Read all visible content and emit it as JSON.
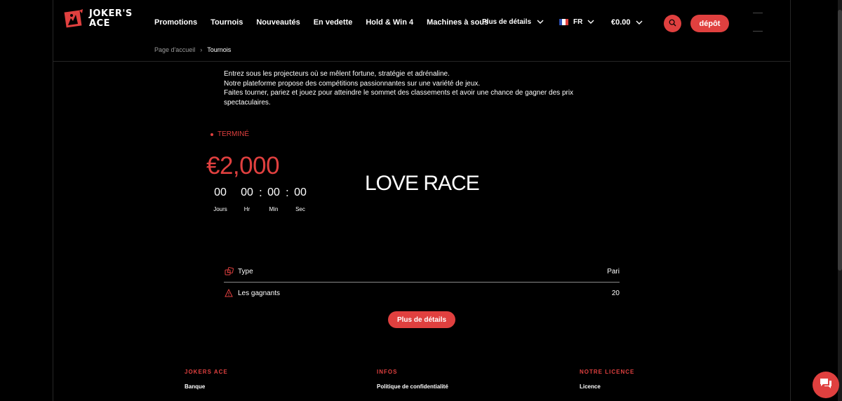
{
  "brand": {
    "line1": "JOKER'S",
    "line2": "ACE",
    "accent": "#e0403f"
  },
  "nav": {
    "items": [
      {
        "label": "Promotions"
      },
      {
        "label": "Tournois"
      },
      {
        "label": "Nouveautés"
      },
      {
        "label": "En vedette"
      },
      {
        "label": "Hold & Win 4"
      },
      {
        "label": "Machines à sous"
      }
    ],
    "more_label": "Plus de détails",
    "language": "FR",
    "balance": "€0.00",
    "deposit_label": "dépôt"
  },
  "breadcrumb": {
    "home": "Page d'accueil",
    "separator": "›",
    "current": "Tournois"
  },
  "intro": {
    "line1": "Entrez sous les projecteurs où se mêlent fortune, stratégie et adrénaline.",
    "line2": "Notre plateforme propose des compétitions passionnantes sur une variété de jeux.",
    "line3": "Faites tourner, pariez et jouez pour atteindre le sommet des classements et avoir une chance de gagner des prix spectaculaires."
  },
  "tournament": {
    "status": "TERMINÉ",
    "prize": "€2,000",
    "name": "LOVE RACE",
    "countdown": {
      "days": "00",
      "hours": "00",
      "minutes": "00",
      "seconds": "00",
      "days_label": "Jours",
      "hours_label": "Hr",
      "minutes_label": "Min",
      "seconds_label": "Sec",
      "separator": ":"
    },
    "info": {
      "type_label": "Type",
      "type_value": "Pari",
      "winners_label": "Les gagnants",
      "winners_value": "20"
    },
    "details_button": "Plus de détails"
  },
  "footer": {
    "col1": {
      "heading": "JOKERS ACE",
      "link": "Banque"
    },
    "col2": {
      "heading": "INFOS",
      "link": "Politique de confidentialité"
    },
    "col3": {
      "heading": "NOTRE LICENCE",
      "link": "Licence"
    }
  }
}
